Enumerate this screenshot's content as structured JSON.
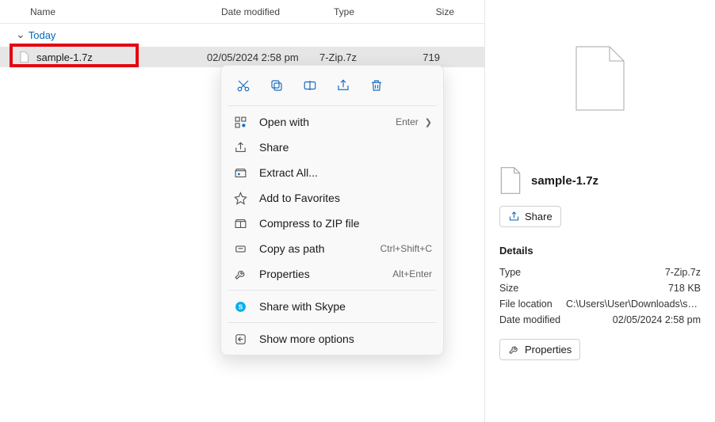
{
  "columns": {
    "name": "Name",
    "date": "Date modified",
    "type": "Type",
    "size": "Size"
  },
  "group": "Today",
  "file": {
    "name": "sample-1.7z",
    "date": "02/05/2024 2:58 pm",
    "type": "7-Zip.7z",
    "size": "719"
  },
  "context": {
    "openwith": "Open with",
    "openwith_accel": "Enter",
    "share": "Share",
    "extract": "Extract All...",
    "favorites": "Add to Favorites",
    "compress": "Compress to ZIP file",
    "copypath": "Copy as path",
    "copypath_accel": "Ctrl+Shift+C",
    "properties": "Properties",
    "properties_accel": "Alt+Enter",
    "skype": "Share with Skype",
    "more": "Show more options"
  },
  "side": {
    "title": "sample-1.7z",
    "share": "Share",
    "details": "Details",
    "rows": {
      "type_k": "Type",
      "type_v": "7-Zip.7z",
      "size_k": "Size",
      "size_v": "718 KB",
      "loc_k": "File location",
      "loc_v": "C:\\Users\\User\\Downloads\\sa...",
      "mod_k": "Date modified",
      "mod_v": "02/05/2024 2:58 pm"
    },
    "properties": "Properties"
  }
}
